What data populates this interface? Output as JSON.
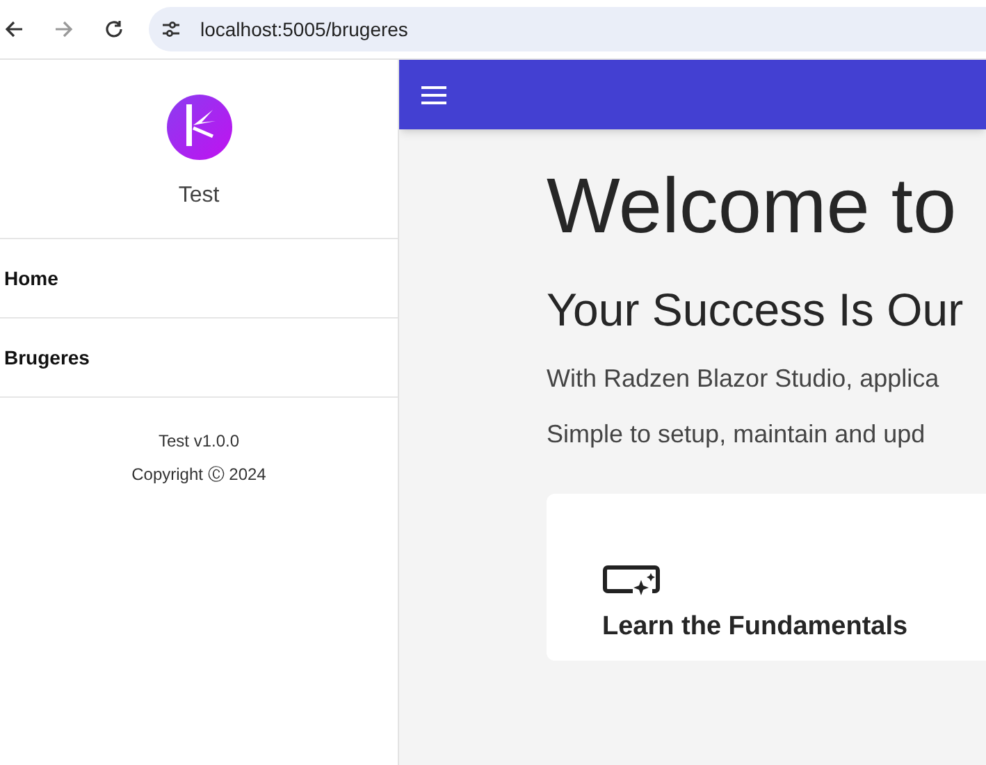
{
  "browser": {
    "url": "localhost:5005/brugeres"
  },
  "sidebar": {
    "app_name": "Test",
    "items": [
      {
        "label": "Home"
      },
      {
        "label": "Brugeres"
      }
    ],
    "footer": [
      "Test v1.0.0",
      "Copyright Ⓒ 2024"
    ]
  },
  "main": {
    "title": "Welcome to",
    "subtitle": "Your Success Is Our",
    "paragraphs": [
      "With Radzen Blazor Studio, applica",
      "Simple to setup, maintain and upd"
    ],
    "card": {
      "title": "Learn the Fundamentals"
    }
  }
}
